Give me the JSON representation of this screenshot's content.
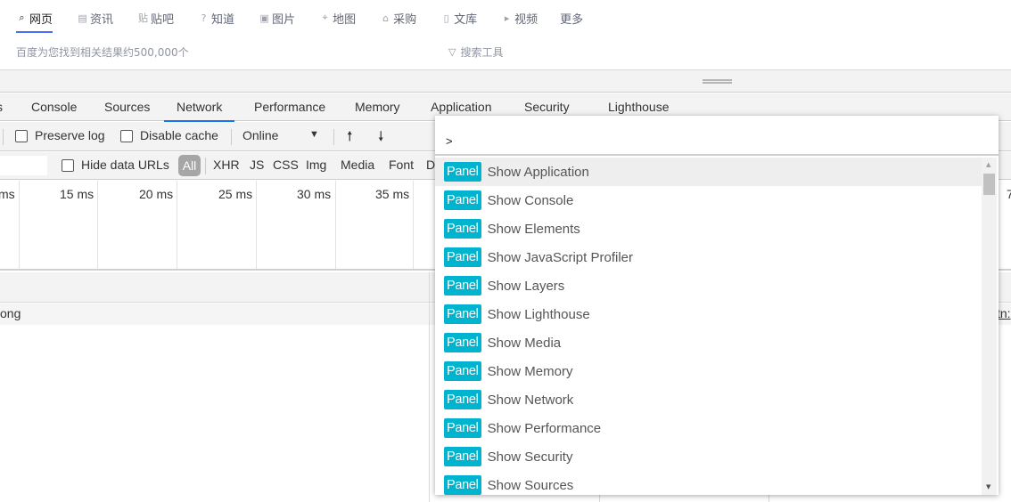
{
  "baidu": {
    "nav": [
      {
        "icon": "search-icon",
        "glyph": "⌕",
        "label": "网页",
        "active": true
      },
      {
        "icon": "news-icon",
        "glyph": "▤",
        "label": "资讯"
      },
      {
        "icon": "tieba-icon",
        "glyph": "贴",
        "label": "贴吧"
      },
      {
        "icon": "question-icon",
        "glyph": "?",
        "label": "知道"
      },
      {
        "icon": "image-icon",
        "glyph": "▣",
        "label": "图片"
      },
      {
        "icon": "map-icon",
        "glyph": "⌖",
        "label": "地图"
      },
      {
        "icon": "shopping-icon",
        "glyph": "⌂",
        "label": "采购"
      },
      {
        "icon": "document-icon",
        "glyph": "▯",
        "label": "文库"
      },
      {
        "icon": "video-icon",
        "glyph": "▸",
        "label": "视频"
      },
      {
        "label": "更多"
      }
    ],
    "result_count": "百度为您找到相关结果约500,000个",
    "search_tools": "搜索工具"
  },
  "devtools": {
    "tabs": [
      "s",
      "Console",
      "Sources",
      "Network",
      "Performance",
      "Memory",
      "Application",
      "Security",
      "Lighthouse"
    ],
    "active_tab": "Network",
    "toolbar": {
      "preserve_log": "Preserve log",
      "disable_cache": "Disable cache",
      "throttling": "Online"
    },
    "filters": {
      "hide_data_urls": "Hide data URLs",
      "types": [
        "All",
        "XHR",
        "JS",
        "CSS",
        "Img",
        "Media",
        "Font",
        "D"
      ]
    },
    "timeline_ticks": [
      "ms",
      "15 ms",
      "20 ms",
      "25 ms",
      "30 ms",
      "35 ms",
      "7"
    ],
    "name_row": {
      "left": "ong",
      "right": "tn:"
    }
  },
  "command_menu": {
    "prompt": ">",
    "badge": "Panel",
    "items": [
      "Show Application",
      "Show Console",
      "Show Elements",
      "Show JavaScript Profiler",
      "Show Layers",
      "Show Lighthouse",
      "Show Media",
      "Show Memory",
      "Show Network",
      "Show Performance",
      "Show Security",
      "Show Sources"
    ],
    "selected_index": 0
  }
}
